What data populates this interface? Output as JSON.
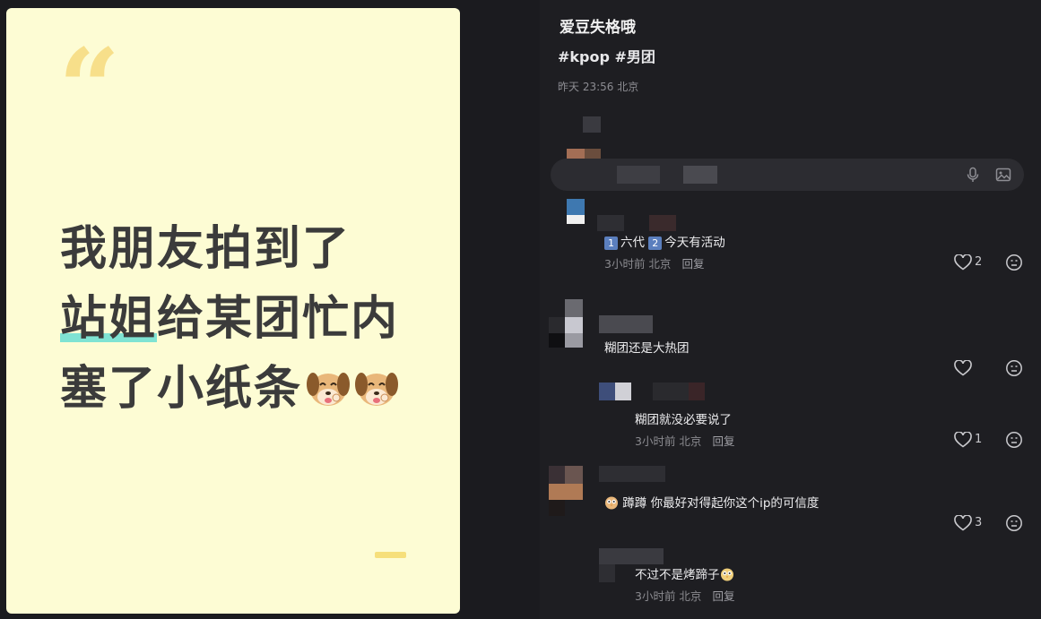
{
  "card": {
    "quote_mark": "“",
    "line1": "我朋友拍到了",
    "line2_highlight": "站姐",
    "line2_rest": "给某团忙内",
    "line3": "塞了小纸条"
  },
  "post": {
    "title": "爱豆失格哦",
    "tags": "#kpop #男团",
    "time": "昨天 23:56 北京"
  },
  "comments": [
    {
      "badge1": "1",
      "mid": "六代",
      "badge2": "2",
      "text": "今天有活动",
      "meta": "3小时前 北京",
      "reply": "回复",
      "likes": "2"
    },
    {
      "text": "糊团还是大热团",
      "likes": ""
    },
    {
      "text": "糊团就没必要说了",
      "meta": "3小时前 北京",
      "reply": "回复",
      "likes": "1"
    },
    {
      "text": "蹲蹲 你最好对得起你这个ip的可信度",
      "likes": "3"
    },
    {
      "text": "不过不是烤蹄子",
      "meta": "3小时前 北京",
      "reply": "回复"
    }
  ],
  "icons": {
    "mic": "microphone-icon",
    "image": "image-icon",
    "like": "heart-icon",
    "reaction": "emoji-face-icon"
  },
  "colors": {
    "card_bg": "#fdfcd4",
    "highlight": "#7fe3d3",
    "panel_bg": "#1e1e22",
    "badge": "#5b7fbe"
  }
}
